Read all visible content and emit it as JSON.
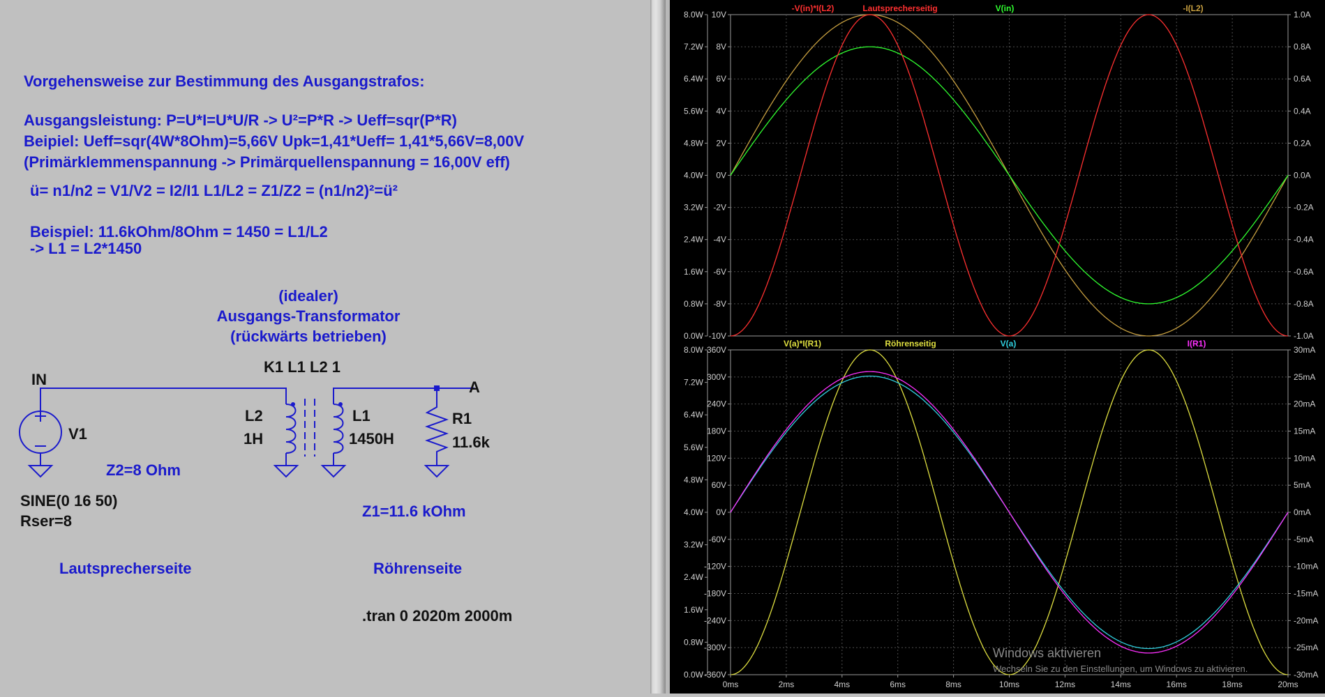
{
  "schematic": {
    "heading": "Vorgehensweise zur Bestimmung des Ausgangstrafos:",
    "lines": [
      "Ausgangsleistung: P=U*I=U*U/R -> U²=P*R  -> Ueff=sqr(P*R)",
      "Beipiel: Ueff=sqr(4W*8Ohm)=5,66V  Upk=1,41*Ueff= 1,41*5,66V=8,00V",
      "(Primärklemmenspannung -> Primärquellenspannung = 16,00V eff)",
      "ü= n1/n2 = V1/V2 = I2/I1     L1/L2 = Z1/Z2 = (n1/n2)²=ü²",
      "Beispiel:  11.6kOhm/8Ohm  = 1450 = L1/L2",
      "-> L1 = L2*1450"
    ],
    "transformer_title": [
      "(idealer)",
      "Ausgangs-Transformator",
      "(rückwärts betrieben)"
    ],
    "coupling": "K1 L1 L2  1",
    "net_in": "IN",
    "net_a": "A",
    "v1_name": "V1",
    "l2_name": "L2",
    "l2_value": "1H",
    "l1_name": "L1",
    "l1_value": "1450H",
    "r1_name": "R1",
    "r1_value": "11.6k",
    "z2": "Z2=8 Ohm",
    "z1": "Z1=11.6 kOhm",
    "source_spec": [
      "SINE(0 16 50)",
      "Rser=8"
    ],
    "side_left": "Lautsprecherseite",
    "side_right": "Röhrenseite",
    "directive": ".tran 0 2020m 2000m"
  },
  "plots": {
    "top": {
      "labels": [
        {
          "text": "-V(in)*I(L2)",
          "color": "#ff3030"
        },
        {
          "text": "Lautsprecherseitig",
          "color": "#ff3030"
        },
        {
          "text": "V(in)",
          "color": "#30ff30"
        },
        {
          "text": "-I(L2)",
          "color": "#c8a040"
        }
      ],
      "left_ticks": [
        "8.0W",
        "7.2W",
        "6.4W",
        "5.6W",
        "4.8W",
        "4.0W",
        "3.2W",
        "2.4W",
        "1.6W",
        "0.8W",
        "0.0W"
      ],
      "mid_ticks": [
        "10V",
        "8V",
        "6V",
        "4V",
        "2V",
        "0V",
        "-2V",
        "-4V",
        "-6V",
        "-8V",
        "-10V"
      ],
      "right_ticks": [
        "1.0A",
        "0.8A",
        "0.6A",
        "0.4A",
        "0.2A",
        "0.0A",
        "-0.2A",
        "-0.4A",
        "-0.6A",
        "-0.8A",
        "-1.0A"
      ]
    },
    "bottom": {
      "labels": [
        {
          "text": "V(a)*I(R1)",
          "color": "#e0e040"
        },
        {
          "text": "Röhrenseitig",
          "color": "#e0e040"
        },
        {
          "text": "V(a)",
          "color": "#30d0e0"
        },
        {
          "text": "I(R1)",
          "color": "#ff30ff"
        }
      ],
      "left_ticks": [
        "8.0W",
        "7.2W",
        "6.4W",
        "5.6W",
        "4.8W",
        "4.0W",
        "3.2W",
        "2.4W",
        "1.6W",
        "0.8W",
        "0.0W"
      ],
      "mid_ticks": [
        "360V",
        "300V",
        "240V",
        "180V",
        "120V",
        "60V",
        "0V",
        "-60V",
        "-120V",
        "-180V",
        "-240V",
        "-300V",
        "-360V"
      ],
      "right_ticks": [
        "30mA",
        "25mA",
        "20mA",
        "15mA",
        "10mA",
        "5mA",
        "0mA",
        "-5mA",
        "-10mA",
        "-15mA",
        "-20mA",
        "-25mA",
        "-30mA"
      ]
    },
    "x_ticks": [
      "0ms",
      "2ms",
      "4ms",
      "6ms",
      "8ms",
      "10ms",
      "12ms",
      "14ms",
      "16ms",
      "18ms",
      "20ms"
    ],
    "colors": {
      "power_top": "#ff3030",
      "vin": "#30ff30",
      "il2": "#c8a040",
      "power_bottom": "#e0e040",
      "va": "#30d0e0",
      "ir1": "#ff30ff",
      "grid": "#505050",
      "wire": "#1a1acc"
    }
  },
  "watermark": {
    "title": "Windows aktivieren",
    "subtitle": "Wechseln Sie zu den Einstellungen, um Windows zu aktivieren."
  }
}
